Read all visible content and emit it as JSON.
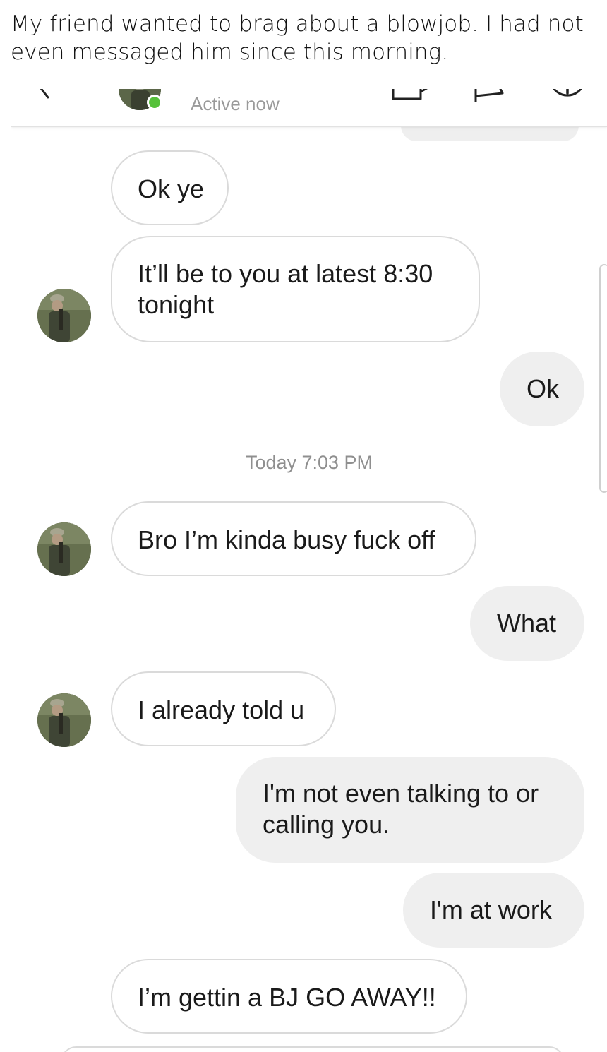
{
  "caption": {
    "line1": "My friend wanted to brag about a blowjob. I had not",
    "line2": "even messaged him since this morning."
  },
  "header": {
    "status": "Active now",
    "icons": [
      "back-arrow-icon",
      "avatar",
      "video-call-icon",
      "flag-icon",
      "info-icon"
    ],
    "online_color": "#56c13a"
  },
  "conversation": {
    "messages": [
      {
        "side": "received",
        "text": "Ok ye"
      },
      {
        "side": "received",
        "lines": [
          "It’ll be to you at latest 8:30",
          "tonight"
        ]
      },
      {
        "side": "sent",
        "text": "Ok"
      },
      {
        "type": "timestamp",
        "text": "Today 7:03 PM"
      },
      {
        "side": "received",
        "text": "Bro I’m kinda busy fuck off"
      },
      {
        "side": "sent",
        "text": "What"
      },
      {
        "side": "received",
        "text": "I already told u"
      },
      {
        "side": "sent",
        "lines": [
          "I'm not even talking to or",
          "calling you."
        ]
      },
      {
        "side": "sent",
        "text": "I'm at work"
      },
      {
        "side": "received",
        "text": "I’m gettin a BJ GO AWAY!!"
      }
    ]
  },
  "colors": {
    "sent_bubble": "#efefef",
    "received_border": "#dadada",
    "timestamp_text": "#8f8f8f"
  }
}
